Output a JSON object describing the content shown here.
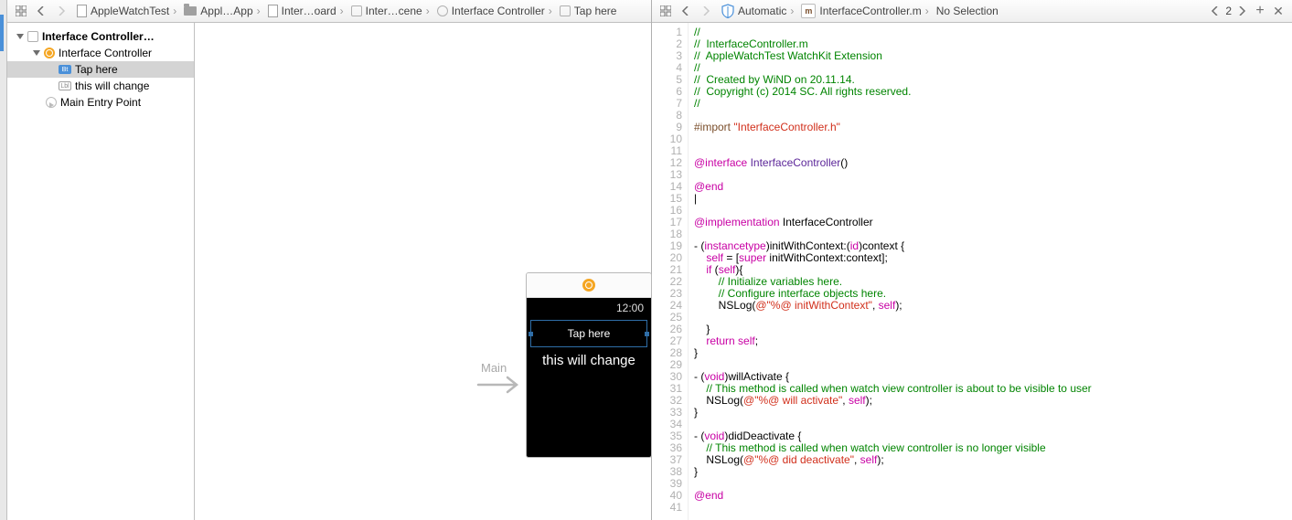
{
  "left_crumbs": {
    "project": "AppleWatchTest",
    "folder": "Appl…App",
    "storyboard": "Inter…oard",
    "scene": "Inter…cene",
    "controller": "Interface Controller",
    "button": "Tap here"
  },
  "right_crumbs": {
    "mode": "Automatic",
    "file": "InterfaceController.m",
    "selection": "No Selection",
    "counter": "2"
  },
  "outline": {
    "scene": "Interface Controller…",
    "controller": "Interface Controller",
    "button": "Tap here",
    "label": "this will change",
    "entry": "Main Entry Point",
    "btn_glyph": "Bt",
    "lbl_glyph": "Lbl"
  },
  "canvas": {
    "arrow_label": "Main",
    "time": "12:00",
    "button_text": "Tap here",
    "label_text": "this will change"
  },
  "code_lines": [
    {
      "t": "//",
      "cls": "c-comment"
    },
    {
      "t": "//  InterfaceController.m",
      "cls": "c-comment"
    },
    {
      "t": "//  AppleWatchTest WatchKit Extension",
      "cls": "c-comment"
    },
    {
      "t": "//",
      "cls": "c-comment"
    },
    {
      "t": "//  Created by WiND on 20.11.14.",
      "cls": "c-comment"
    },
    {
      "t": "//  Copyright (c) 2014 SC. All rights reserved.",
      "cls": "c-comment"
    },
    {
      "t": "//",
      "cls": "c-comment"
    },
    {
      "t": "",
      "cls": ""
    },
    {
      "html": "<span class='c-pp'>#import </span><span class='c-str'>\"InterfaceController.h\"</span>"
    },
    {
      "t": "",
      "cls": ""
    },
    {
      "t": "",
      "cls": ""
    },
    {
      "html": "<span class='c-kw'>@interface</span> <span class='c-cls'>InterfaceController</span>()"
    },
    {
      "t": "",
      "cls": ""
    },
    {
      "html": "<span class='c-kw'>@end</span>"
    },
    {
      "t": "|",
      "cls": ""
    },
    {
      "t": "",
      "cls": ""
    },
    {
      "html": "<span class='c-kw'>@implementation</span> InterfaceController"
    },
    {
      "t": "",
      "cls": ""
    },
    {
      "html": "- (<span class='c-kw'>instancetype</span>)initWithContext:(<span class='c-kw'>id</span>)context {"
    },
    {
      "html": "    <span class='c-kw'>self</span> = [<span class='c-kw'>super</span> initWithContext:context];"
    },
    {
      "html": "    <span class='c-kw'>if</span> (<span class='c-kw'>self</span>){"
    },
    {
      "html": "        <span class='c-comment'>// Initialize variables here.</span>"
    },
    {
      "html": "        <span class='c-comment'>// Configure interface objects here.</span>"
    },
    {
      "html": "        NSLog(<span class='c-str'>@\"%@ initWithContext\"</span>, <span class='c-kw'>self</span>);"
    },
    {
      "t": "",
      "cls": ""
    },
    {
      "t": "    }",
      "cls": ""
    },
    {
      "html": "    <span class='c-kw'>return</span> <span class='c-kw'>self</span>;"
    },
    {
      "t": "}",
      "cls": ""
    },
    {
      "t": "",
      "cls": ""
    },
    {
      "html": "- (<span class='c-kw'>void</span>)willActivate {"
    },
    {
      "html": "    <span class='c-comment'>// This method is called when watch view controller is about to be visible to user</span>"
    },
    {
      "html": "    NSLog(<span class='c-str'>@\"%@ will activate\"</span>, <span class='c-kw'>self</span>);"
    },
    {
      "t": "}",
      "cls": ""
    },
    {
      "t": "",
      "cls": ""
    },
    {
      "html": "- (<span class='c-kw'>void</span>)didDeactivate {"
    },
    {
      "html": "    <span class='c-comment'>// This method is called when watch view controller is no longer visible</span>"
    },
    {
      "html": "    NSLog(<span class='c-str'>@\"%@ did deactivate\"</span>, <span class='c-kw'>self</span>);"
    },
    {
      "t": "}",
      "cls": ""
    },
    {
      "t": "",
      "cls": ""
    },
    {
      "html": "<span class='c-kw'>@end</span>"
    },
    {
      "t": "",
      "cls": ""
    }
  ]
}
